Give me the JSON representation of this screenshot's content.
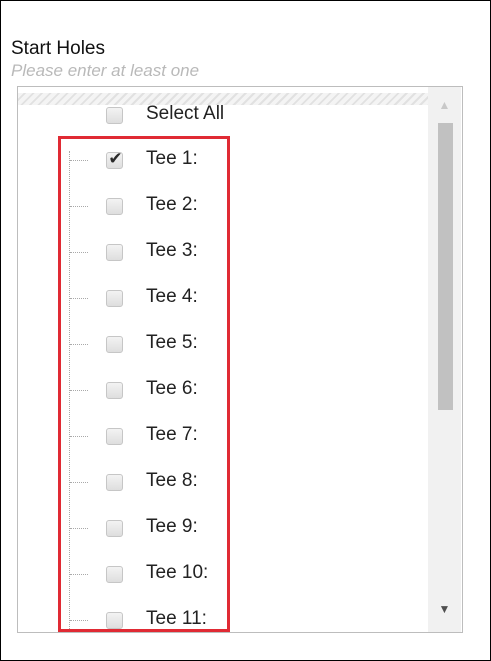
{
  "field": {
    "label": "Start Holes",
    "hint": "Please enter at least one"
  },
  "select_all": {
    "label": "Select All",
    "checked": false
  },
  "items": [
    {
      "label": "Tee 1:",
      "checked": true
    },
    {
      "label": "Tee 2:",
      "checked": false
    },
    {
      "label": "Tee 3:",
      "checked": false
    },
    {
      "label": "Tee 4:",
      "checked": false
    },
    {
      "label": "Tee 5:",
      "checked": false
    },
    {
      "label": "Tee 6:",
      "checked": false
    },
    {
      "label": "Tee 7:",
      "checked": false
    },
    {
      "label": "Tee 8:",
      "checked": false
    },
    {
      "label": "Tee 9:",
      "checked": false
    },
    {
      "label": "Tee 10:",
      "checked": false
    },
    {
      "label": "Tee 11:",
      "checked": false
    }
  ],
  "scrollbar": {
    "up_icon": "scroll-up-arrow-icon",
    "down_icon": "scroll-down-arrow-icon"
  },
  "colors": {
    "highlight": "#e02a34",
    "hint": "#b9b9b9"
  }
}
